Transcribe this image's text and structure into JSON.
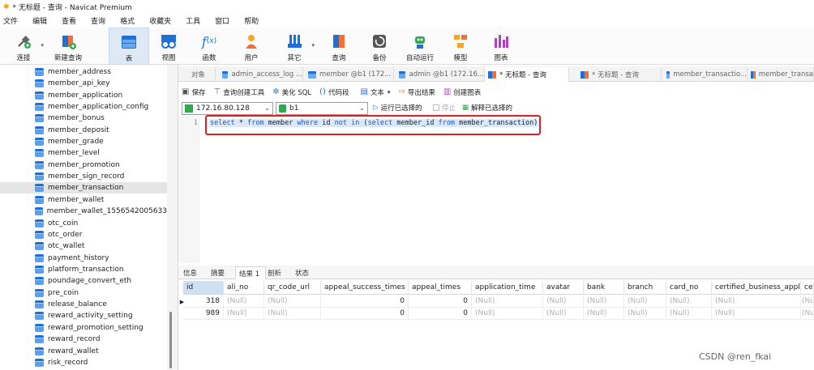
{
  "window": {
    "title": "* 无标题 - 查询 - Navicat Premium"
  },
  "menu": [
    "文件",
    "编辑",
    "查看",
    "查询",
    "格式",
    "收藏夹",
    "工具",
    "窗口",
    "帮助"
  ],
  "toolbar": {
    "connect": "连接",
    "new_query": "新建查询",
    "table": "表",
    "view": "视图",
    "function": "函数",
    "user": "用户",
    "other": "其它",
    "query": "查询",
    "backup": "备份",
    "automation": "自动运行",
    "model": "模型",
    "chart": "图表"
  },
  "sidebar": {
    "items": [
      "member_address",
      "member_api_key",
      "member_application",
      "member_application_config",
      "member_bonus",
      "member_deposit",
      "member_grade",
      "member_level",
      "member_promotion",
      "member_sign_record",
      "member_transaction",
      "member_wallet",
      "member_wallet_1556542005633",
      "otc_coin",
      "otc_order",
      "otc_wallet",
      "payment_history",
      "platform_transaction",
      "poundage_convert_eth",
      "pre_coin",
      "release_balance",
      "reward_activity_setting",
      "reward_promotion_setting",
      "reward_record",
      "reward_wallet",
      "risk_record"
    ],
    "selected": "member_transaction"
  },
  "tabs": [
    "对象",
    "admin_access_log ...",
    "member @b1 (172...",
    "admin @b1 (172.16...",
    "* 无标题 - 查询",
    "* 无标题 - 查询",
    "member_transactio...",
    "member_transa"
  ],
  "query_toolbar": {
    "save": "保存",
    "builder": "查询创建工具",
    "beautify": "美化 SQL",
    "snippet": "代码段",
    "text": "文本",
    "export": "导出结果",
    "create_chart": "创建图表"
  },
  "connection": {
    "host": "172.16.80.128",
    "database": "b1",
    "run_selected": "运行已选择的",
    "stop": "停止",
    "explain": "解释已选择的"
  },
  "editor": {
    "line_number": "1",
    "sql": {
      "k1": "select",
      "t1": " * ",
      "k2": "from",
      "t2": " member ",
      "k3": "where",
      "t3": " id ",
      "k4": "not in",
      "t4": " (",
      "k5": "select",
      "t5": " member_id ",
      "k6": "from",
      "t6": " member_transaction)"
    }
  },
  "result_tabs": [
    "信息",
    "摘要",
    "结果 1",
    "剖析",
    "状态"
  ],
  "grid": {
    "columns": [
      "id",
      "ali_no",
      "qr_code_url",
      "appeal_success_times",
      "appeal_times",
      "application_time",
      "avatar",
      "bank",
      "branch",
      "card_no",
      "certified_business_apply_t",
      "cer"
    ],
    "rows": [
      [
        "318",
        "(Null)",
        "(Null)",
        "0",
        "0",
        "(Null)",
        "(Null)",
        "(Null)",
        "(Null)",
        "(Null)",
        "(Null)",
        "(Nu"
      ],
      [
        "989",
        "(Null)",
        "(Null)",
        "0",
        "0",
        "(Null)",
        "(Null)",
        "(Null)",
        "(Null)",
        "(Null)",
        "(Null)",
        "(Nu"
      ]
    ]
  },
  "watermark": "CSDN @ren_fkai"
}
